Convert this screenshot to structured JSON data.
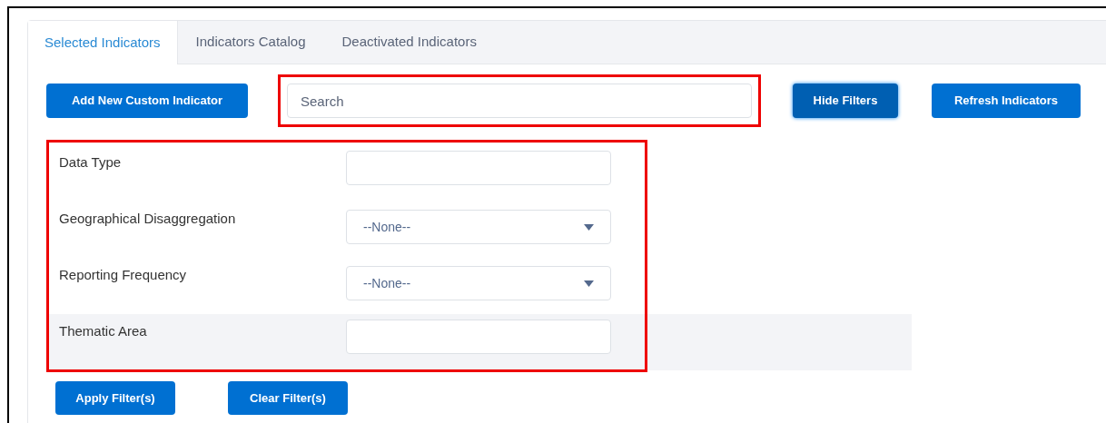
{
  "tabs": [
    {
      "label": "Selected Indicators",
      "selected": true
    },
    {
      "label": "Indicators Catalog",
      "selected": false
    },
    {
      "label": "Deactivated Indicators",
      "selected": false
    }
  ],
  "toolbar": {
    "add_button": "Add New Custom Indicator",
    "search": {
      "placeholder": "Search"
    },
    "hide_button": {
      "label": "Hide Filters",
      "pressed": true
    },
    "refresh_button": "Refresh Indicators"
  },
  "filters": [
    {
      "label": "Data Type",
      "kind": "text",
      "shaded": false
    },
    {
      "label": "Geographical Disaggregation",
      "kind": "select",
      "value": "--None--",
      "shaded": false
    },
    {
      "label": "Reporting Frequency",
      "kind": "select",
      "value": "--None--",
      "shaded": false
    },
    {
      "label": "Thematic Area",
      "kind": "text",
      "shaded": true
    }
  ],
  "filter_buttons": [
    "Apply Filter(s)",
    "Clear Filter(s)"
  ]
}
